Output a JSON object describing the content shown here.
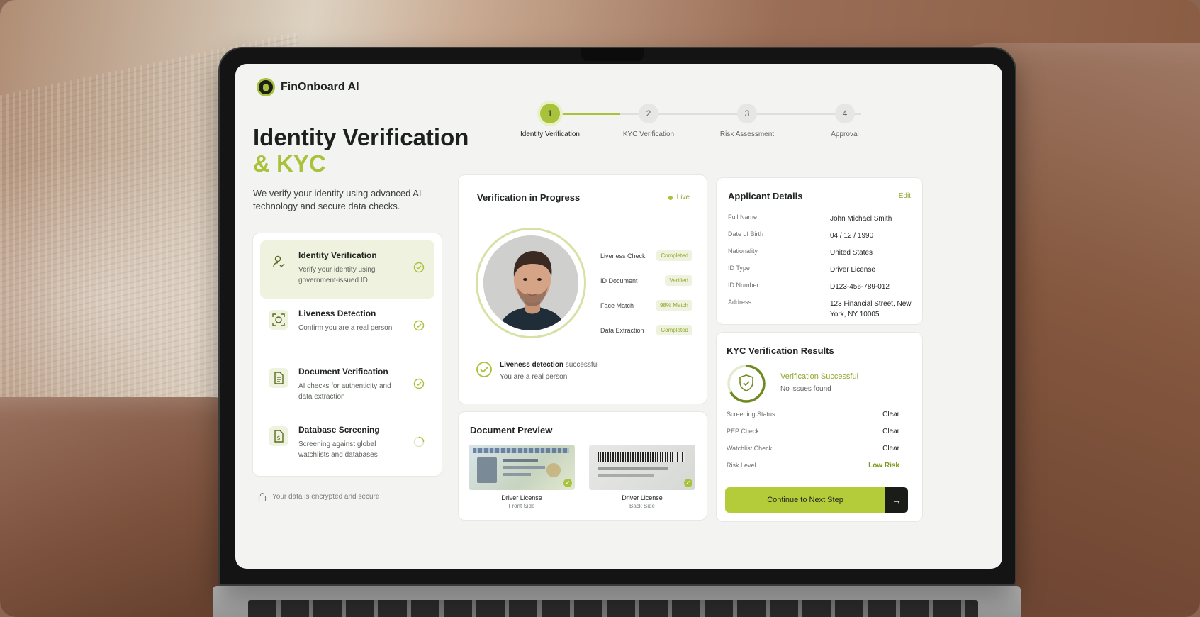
{
  "brand": {
    "name": "FinOnboard AI"
  },
  "hero": {
    "title_line1": "Identity Verification",
    "title_line2": "& KYC",
    "description": "We verify your identity using advanced AI technology and secure data checks."
  },
  "stepper": [
    {
      "number": "1",
      "label": "Identity Verification",
      "state": "active"
    },
    {
      "number": "2",
      "label": "KYC Verification",
      "state": "pending"
    },
    {
      "number": "3",
      "label": "Risk Assessment",
      "state": "pending"
    },
    {
      "number": "4",
      "label": "Approval",
      "state": "pending"
    }
  ],
  "steps": [
    {
      "title": "Identity Verification",
      "description": "Verify your identity using government-issued ID",
      "icon": "user-check-icon",
      "status": "done"
    },
    {
      "title": "Liveness Detection",
      "description": "Confirm you are a real person",
      "icon": "face-scan-icon",
      "status": "done"
    },
    {
      "title": "Document Verification",
      "description": "AI checks for authenticity and data extraction",
      "icon": "document-icon",
      "status": "done"
    },
    {
      "title": "Database Screening",
      "description": "Screening against global watchlists and databases",
      "icon": "database-doc-icon",
      "status": "loading"
    }
  ],
  "secure_note": "Your data is encrypted and secure",
  "verification": {
    "title": "Verification in Progress",
    "live_label": "Live",
    "checks": [
      {
        "label": "Liveness Check",
        "status": "Completed"
      },
      {
        "label": "ID Document",
        "status": "Verified"
      },
      {
        "label": "Face Match",
        "status": "98% Match"
      },
      {
        "label": "Data Extraction",
        "status": "Completed"
      }
    ],
    "message_bold": "Liveness detection",
    "message_rest": " successful",
    "message_sub": "You are a real person"
  },
  "documents": {
    "title": "Document Preview",
    "items": [
      {
        "label": "Driver License",
        "sub": "Front Side"
      },
      {
        "label": "Driver License",
        "sub": "Back Side"
      }
    ]
  },
  "applicant": {
    "title": "Applicant Details",
    "edit": "Edit",
    "fields": [
      {
        "key": "Full Name",
        "value": "John Michael Smith"
      },
      {
        "key": "Date of Birth",
        "value": "04 / 12 / 1990"
      },
      {
        "key": "Nationality",
        "value": "United States"
      },
      {
        "key": "ID Type",
        "value": "Driver License"
      },
      {
        "key": "ID Number",
        "value": "D123-456-789-012"
      },
      {
        "key": "Address",
        "value": "123 Financial Street, New York, NY 10005"
      }
    ]
  },
  "kyc": {
    "title": "KYC Verification Results",
    "success": "Verification Successful",
    "success_sub": "No issues found",
    "rows": [
      {
        "key": "Screening Status",
        "value": "Clear"
      },
      {
        "key": "PEP Check",
        "value": "Clear"
      },
      {
        "key": "Watchlist Check",
        "value": "Clear"
      },
      {
        "key": "Risk Level",
        "value": "Low Risk"
      }
    ],
    "cta": "Continue to Next Step"
  },
  "colors": {
    "accent": "#a9c23b",
    "dark": "#1f2420"
  }
}
